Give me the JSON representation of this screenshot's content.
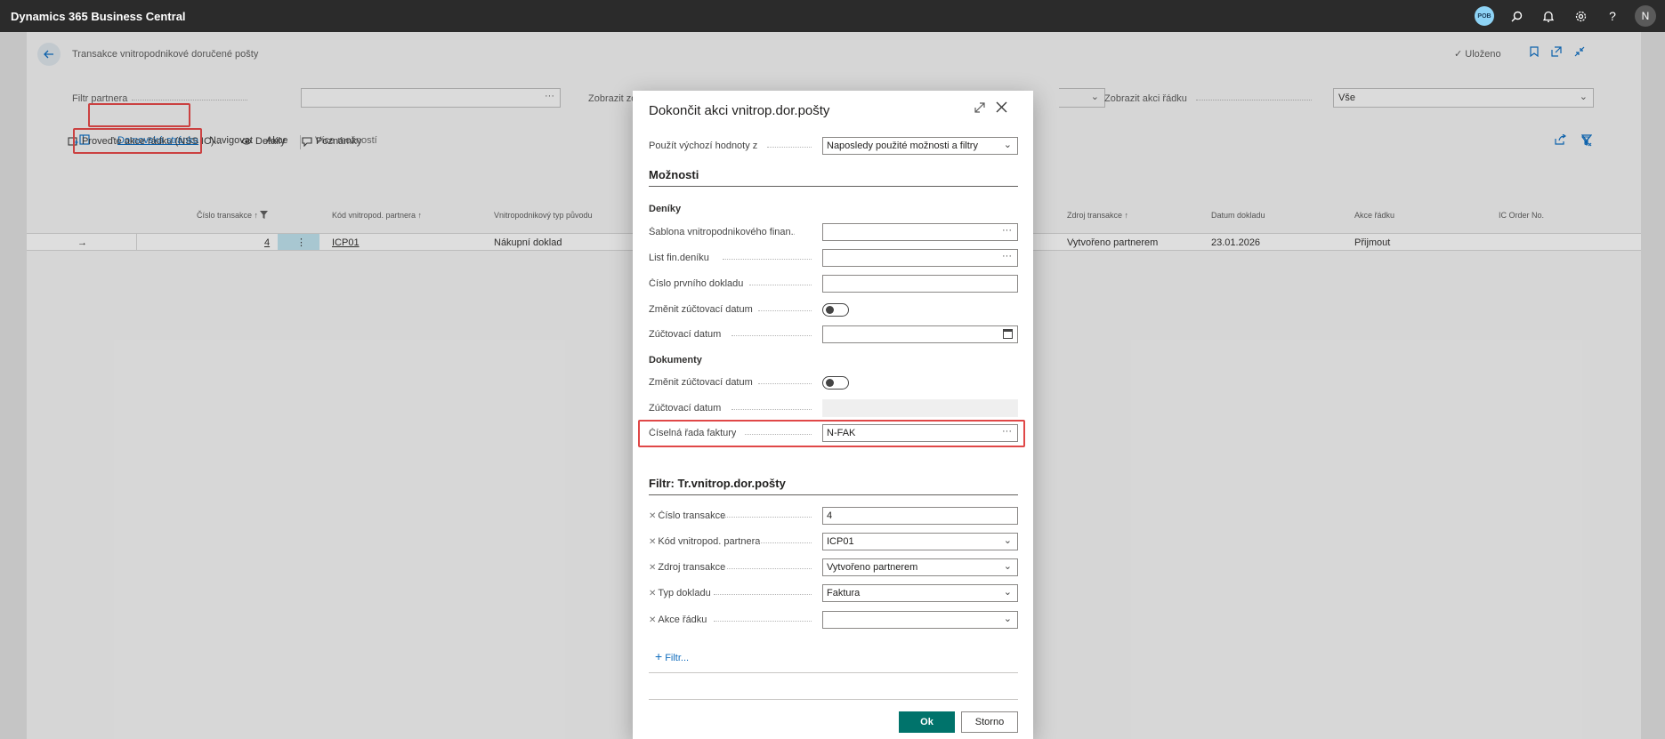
{
  "app": {
    "title": "Dynamics 365 Business Central",
    "badge": "POB",
    "user_initial": "N"
  },
  "page": {
    "title": "Transakce vnitropodnikové doručené pošty",
    "saved": "✓ Uloženo",
    "filters": {
      "partner_label": "Filtr partnera",
      "partner_value": "",
      "show_label": "Zobrazit zo",
      "line_action_label": "Zobrazit akci řádku",
      "line_action_value": "Vše"
    },
    "actions": {
      "home": "Domovská stránka",
      "navigate": "Navigovat",
      "actions": "Akce",
      "more": "Více možností",
      "run_line_actions": "Proveďte akce řádku (NSS IC)...",
      "details": "Detaily",
      "notes": "Poznámky"
    },
    "grid": {
      "columns": [
        "Číslo transakce ↑",
        "Kód vnitropod. partnera ↑",
        "Vnitropodnikový typ původu",
        "Zdroj transakce ↑",
        "Datum dokladu",
        "Akce řádku",
        "IC Order No."
      ],
      "row": {
        "transaction_no": "4",
        "partner_code": "ICP01",
        "origin_type": "Nákupní doklad",
        "source": "Vytvořeno partnerem",
        "document_date": "23.01.2026",
        "line_action": "Přijmout",
        "ic_order_no": ""
      }
    }
  },
  "dialog": {
    "title": "Dokončit akci vnitrop.dor.pošty",
    "defaults_label": "Použít výchozí hodnoty z",
    "defaults_value": "Naposledy použité možnosti a filtry",
    "options_header": "Možnosti",
    "journals_header": "Deníky",
    "journal_template_label": "Šablona vnitropodnikového finan...",
    "journal_template_value": "",
    "journal_batch_label": "List fin.deníku",
    "journal_batch_value": "",
    "first_doc_no_label": "Číslo prvního dokladu",
    "first_doc_no_value": "",
    "change_posting_date_label": "Změnit zúčtovací datum",
    "posting_date_label": "Zúčtovací datum",
    "posting_date_value": "",
    "documents_header": "Dokumenty",
    "doc_change_posting_date_label": "Změnit zúčtovací datum",
    "doc_posting_date_label": "Zúčtovací datum",
    "doc_posting_date_value": "",
    "invoice_series_label": "Číselná řada faktury",
    "invoice_series_value": "N-FAK",
    "filter_header": "Filtr: Tr.vnitrop.dor.pošty",
    "filter_transaction_no_label": "Číslo transakce",
    "filter_transaction_no_value": "4",
    "filter_partner_code_label": "Kód vnitropod. partnera",
    "filter_partner_code_value": "ICP01",
    "filter_source_label": "Zdroj transakce",
    "filter_source_value": "Vytvořeno partnerem",
    "filter_doc_type_label": "Typ dokladu",
    "filter_doc_type_value": "Faktura",
    "filter_line_action_label": "Akce řádku",
    "filter_line_action_value": "",
    "add_filter": "Filtr...",
    "ok": "Ok",
    "cancel": "Storno"
  },
  "colors": {
    "accent": "#0f6cbd",
    "primary_button": "#00736b",
    "highlight": "#e04848",
    "topbar": "#2b2b2b"
  }
}
